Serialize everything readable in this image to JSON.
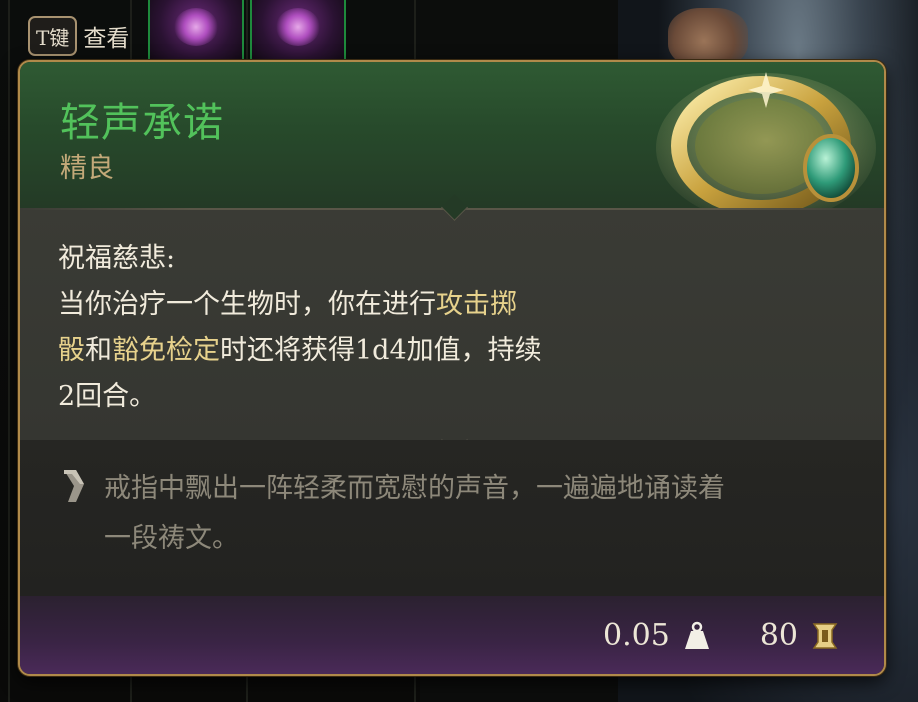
{
  "hint": {
    "key": "T键",
    "label": "查看"
  },
  "item": {
    "name": "轻声承诺",
    "rarity": "精良",
    "effect": {
      "title": "祝福慈悲:",
      "line1_a": "当你治疗一个生物时，你在进行",
      "line1_b": "攻击掷",
      "line2_a": "骰",
      "line2_b": "和",
      "line2_c": "豁免检定",
      "line2_d": "时还将获得1d4加值，持续",
      "line3": "2回合。"
    },
    "flavor": {
      "line1": "戒指中飘出一阵轻柔而宽慰的声音，一遍遍地诵读着",
      "line2": "一段祷文。"
    },
    "weight": "0.05",
    "value": "80"
  },
  "colors": {
    "name": "#52c25b",
    "rarity": "#c3a979",
    "highlight": "#e7d28c",
    "border": "#b08a4a"
  },
  "icons": {
    "weight": "weight-icon",
    "gold": "gold-coin-icon",
    "quote": "quote-icon",
    "ring": "ring-item-icon"
  }
}
